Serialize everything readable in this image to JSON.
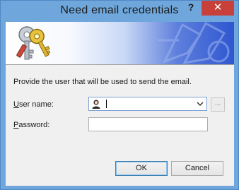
{
  "window": {
    "title": "Need email credentials",
    "help_label": "?",
    "close_label": "✕"
  },
  "dialog": {
    "instruction": "Provide the user that will be used to send the email.",
    "user_label_acc": "U",
    "user_label_rest": "ser name:",
    "user_value": "",
    "browse_label": "...",
    "password_label_acc": "P",
    "password_label_rest": "assword:",
    "password_value": ""
  },
  "buttons": {
    "ok_label": "OK",
    "cancel_label": "Cancel"
  },
  "icons": {
    "banner": "keys-icon",
    "user": "user-icon",
    "dropdown": "chevron-down-icon"
  }
}
